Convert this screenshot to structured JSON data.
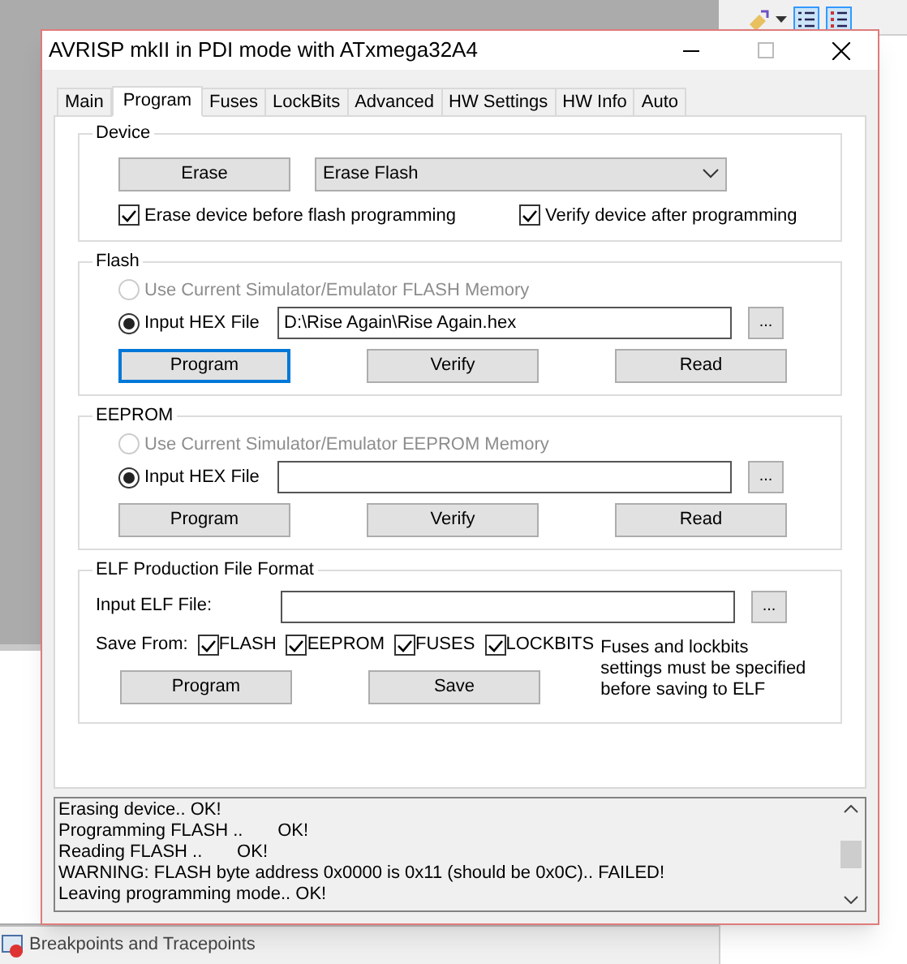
{
  "window": {
    "title": "AVRISP mkII in PDI mode with ATxmega32A4"
  },
  "tabs": [
    {
      "label": "Main",
      "selected": false
    },
    {
      "label": "Program",
      "selected": true
    },
    {
      "label": "Fuses",
      "selected": false
    },
    {
      "label": "LockBits",
      "selected": false
    },
    {
      "label": "Advanced",
      "selected": false
    },
    {
      "label": "HW Settings",
      "selected": false
    },
    {
      "label": "HW Info",
      "selected": false
    },
    {
      "label": "Auto",
      "selected": false
    }
  ],
  "device": {
    "title": "Device",
    "erase_button": "Erase",
    "erase_mode": "Erase Flash",
    "options": [
      {
        "label": "Erase device before flash programming",
        "checked": true
      },
      {
        "label": "Verify device after programming",
        "checked": true
      }
    ]
  },
  "memories": [
    {
      "title": "Flash",
      "sources": [
        {
          "label": "Use Current Simulator/Emulator FLASH Memory",
          "selected": false,
          "disabled": true
        },
        {
          "label": "Input HEX File",
          "selected": true,
          "disabled": false
        }
      ],
      "file": "D:\\Rise Again\\Rise Again.hex",
      "browse": "...",
      "buttons": [
        {
          "label": "Program",
          "focused": true
        },
        {
          "label": "Verify",
          "focused": false
        },
        {
          "label": "Read",
          "focused": false
        }
      ]
    },
    {
      "title": "EEPROM",
      "sources": [
        {
          "label": "Use Current Simulator/Emulator EEPROM Memory",
          "selected": false,
          "disabled": true
        },
        {
          "label": "Input HEX File",
          "selected": true,
          "disabled": false
        }
      ],
      "browse": "...",
      "buttons": [
        {
          "label": "Program",
          "focused": false
        },
        {
          "label": "Verify",
          "focused": false
        },
        {
          "label": "Read",
          "focused": false
        }
      ]
    }
  ],
  "elf": {
    "title": "ELF Production File Format",
    "input_label": "Input ELF File:",
    "browse": "...",
    "save_from_label": "Save From:",
    "save_from": [
      {
        "label": "FLASH",
        "checked": true
      },
      {
        "label": "EEPROM",
        "checked": true
      },
      {
        "label": "FUSES",
        "checked": true
      },
      {
        "label": "LOCKBITS",
        "checked": true
      }
    ],
    "note": "Fuses and lockbits settings must be specified before saving to ELF",
    "buttons": [
      "Program",
      "Save"
    ]
  },
  "log": {
    "lines": [
      "Erasing device.. OK!",
      "Programming FLASH ..       OK!",
      "Reading FLASH ..       OK!",
      "WARNING: FLASH byte address 0x0000 is 0x11 (should be 0x0C).. FAILED!",
      "Leaving programming mode.. OK!"
    ]
  },
  "background": {
    "panel_tab": "Breakpoints and Tracepoints"
  }
}
